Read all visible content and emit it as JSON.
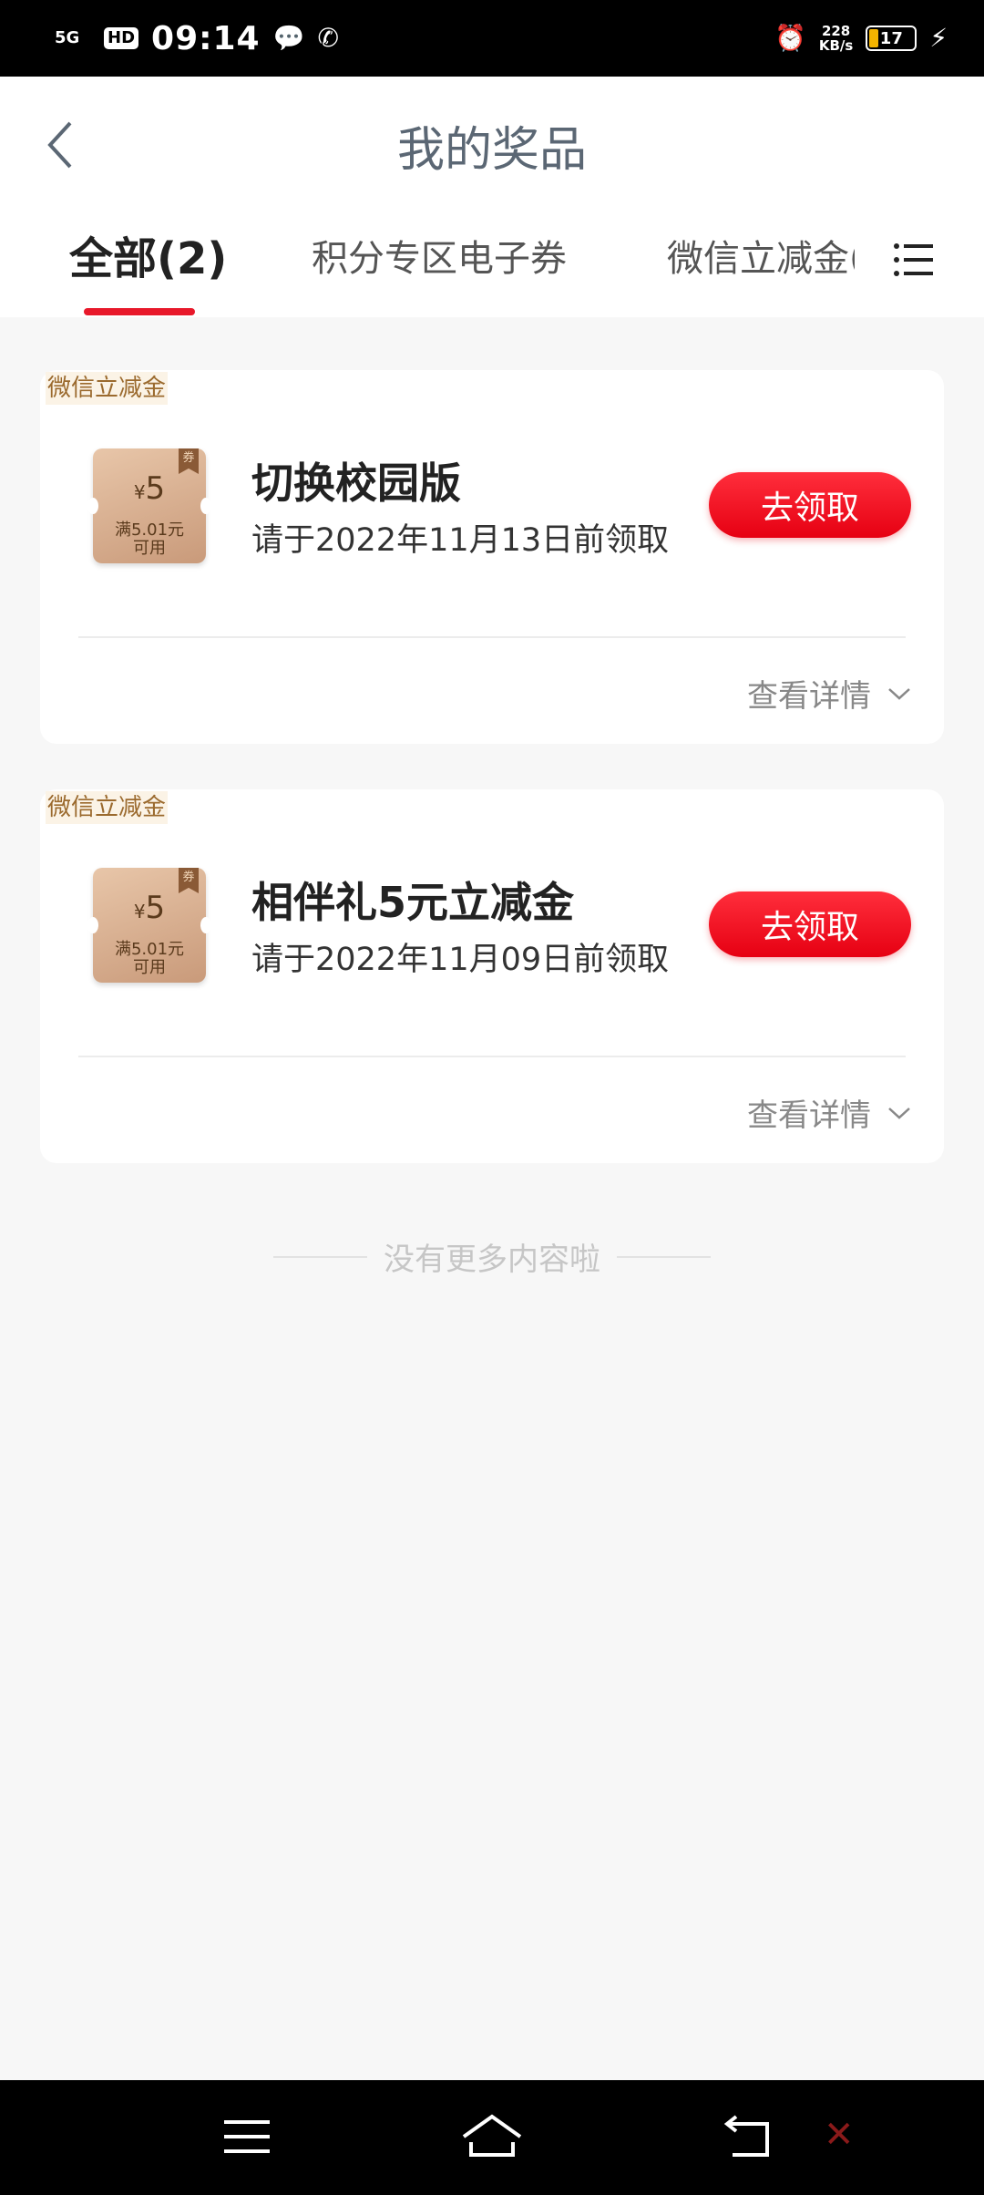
{
  "status_bar": {
    "network": "5G",
    "hd": "HD",
    "time": "09:14",
    "speed_value": "228",
    "speed_unit": "KB/s",
    "battery": "17",
    "battery_color": "#f3b400"
  },
  "header": {
    "title": "我的奖品"
  },
  "tabs": [
    {
      "label": "全部(2)"
    },
    {
      "label": "积分专区电子券"
    },
    {
      "label": "微信立减金("
    }
  ],
  "prizes": [
    {
      "tag": "微信立减金",
      "coupon_currency": "¥",
      "coupon_amount": "5",
      "coupon_condition_1": "满5.01元",
      "coupon_condition_2": "可用",
      "coupon_flag": "券",
      "name": "切换校园版",
      "deadline": "请于2022年11月13日前领取",
      "button": "去领取",
      "details": "查看详情"
    },
    {
      "tag": "微信立减金",
      "coupon_currency": "¥",
      "coupon_amount": "5",
      "coupon_condition_1": "满5.01元",
      "coupon_condition_2": "可用",
      "coupon_flag": "券",
      "name": "相伴礼5元立减金",
      "deadline": "请于2022年11月09日前领取",
      "button": "去领取",
      "details": "查看详情"
    }
  ],
  "end_note": "没有更多内容啦",
  "accent_color": "#e8182a"
}
